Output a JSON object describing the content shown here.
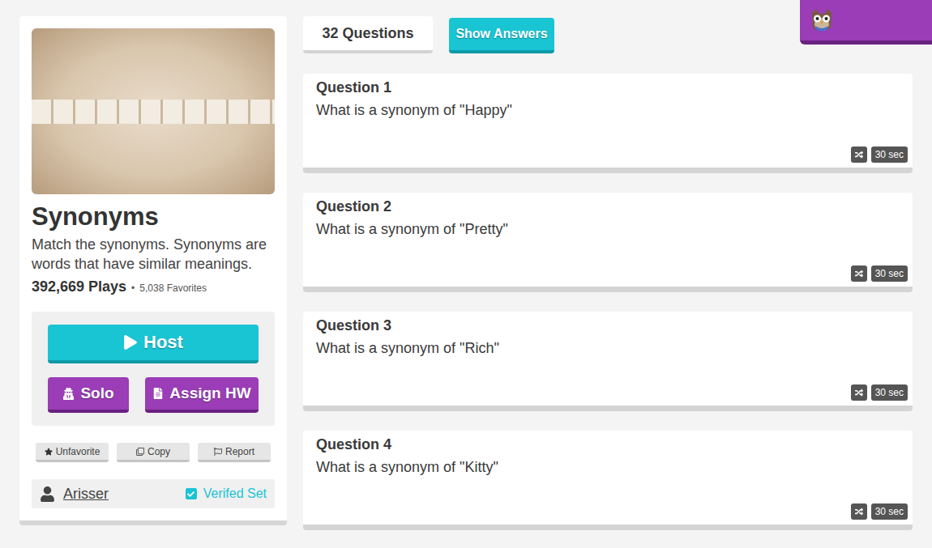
{
  "set": {
    "title": "Synonyms",
    "description": "Match the synonyms. Synonyms are words that have similar meanings.",
    "plays": "392,669 Plays",
    "separator": "•",
    "favorites": "5,038 Favorites",
    "author": "Arisser",
    "verified": true,
    "verified_label": "Verifed Set",
    "favorited": true
  },
  "actions": {
    "host": "Host",
    "solo": "Solo",
    "assign": "Assign HW"
  },
  "small_buttons": [
    "Unfavorite",
    "Copy",
    "Report"
  ],
  "toolbar": {
    "count": "32 Questions",
    "show_answers": "Show Answers"
  },
  "questions": [
    {
      "label": "Question 1",
      "text": "What is a synonym of \"Happy\"",
      "time": "30 sec"
    },
    {
      "label": "Question 2",
      "text": "What is a synonym of \"Pretty\"",
      "time": "30 sec"
    },
    {
      "label": "Question 3",
      "text": "What is a synonym of \"Rich\"",
      "time": "30 sec"
    },
    {
      "label": "Question 4",
      "text": "What is a synonym of \"Kitty\"",
      "time": "30 sec"
    }
  ]
}
